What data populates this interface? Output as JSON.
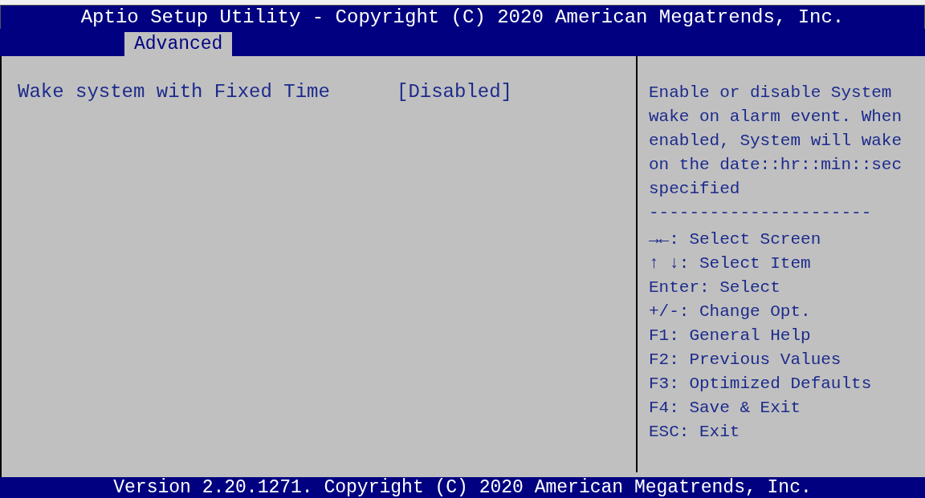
{
  "title": "Aptio Setup Utility - Copyright (C) 2020 American Megatrends, Inc.",
  "tabs": [
    {
      "label": "Advanced",
      "selected": true
    }
  ],
  "settings": [
    {
      "label": "Wake system with Fixed Time",
      "value": "[Disabled]",
      "selected": false
    }
  ],
  "help_text": "Enable or disable System wake on alarm event. When enabled, System will wake on the date::hr::min::sec specified",
  "separator": "----------------------",
  "key_help": [
    "→←: Select Screen",
    "↑ ↓: Select Item",
    "Enter: Select",
    "+/-: Change Opt.",
    "F1: General Help",
    "F2: Previous Values",
    "F3: Optimized Defaults",
    "F4: Save & Exit",
    "ESC: Exit"
  ],
  "footer": "Version 2.20.1271. Copyright (C) 2020 American Megatrends, Inc."
}
